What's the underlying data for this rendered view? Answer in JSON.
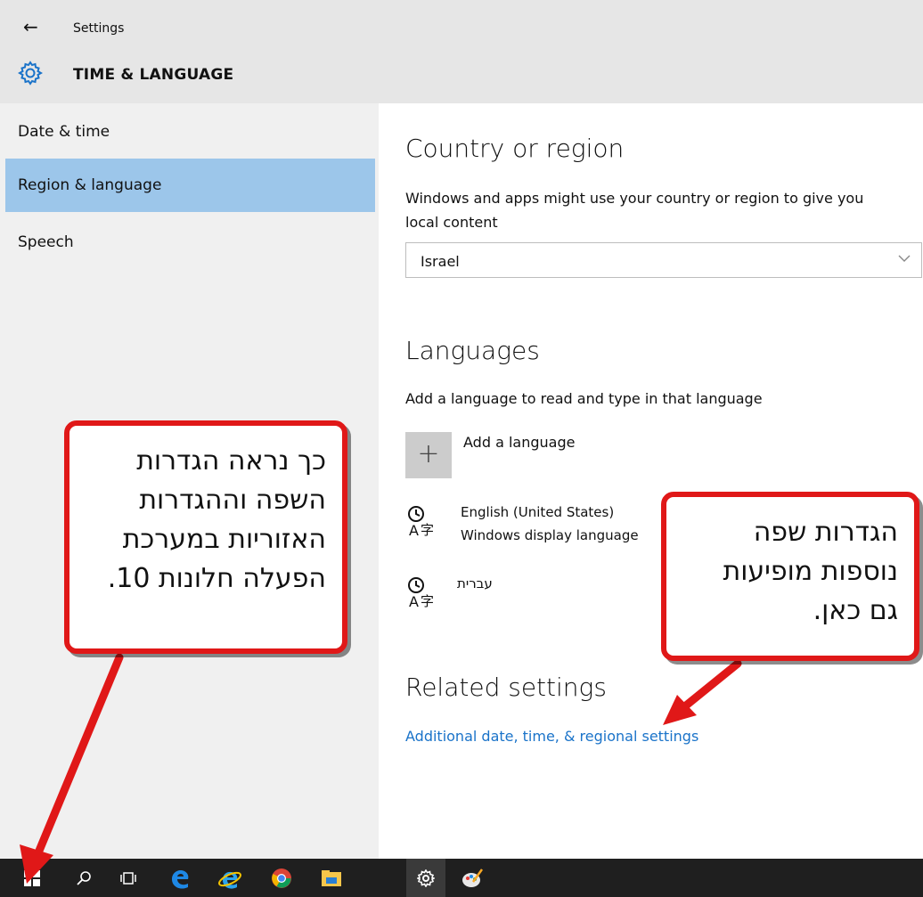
{
  "header": {
    "back_icon": "back-arrow-icon",
    "app_title": "Settings",
    "section_icon": "gear-icon",
    "section_title": "TIME & LANGUAGE"
  },
  "sidebar": {
    "items": [
      {
        "label": "Date & time",
        "selected": false
      },
      {
        "label": "Region & language",
        "selected": true
      },
      {
        "label": "Speech",
        "selected": false
      }
    ]
  },
  "country": {
    "heading": "Country or region",
    "description_line1": "Windows and apps might use your country or region to give you",
    "description_line2": "local content",
    "selected_value": "Israel"
  },
  "languages": {
    "heading": "Languages",
    "description": "Add a language to read and type in that language",
    "add_label": "Add a language",
    "items": [
      {
        "name": "English (United States)",
        "subtitle": "Windows display language"
      },
      {
        "name": "עברית",
        "subtitle": ""
      }
    ]
  },
  "related": {
    "heading": "Related settings",
    "link": "Additional date, time, & regional settings"
  },
  "callouts": {
    "left": [
      "כך נראה הגדרות",
      "השפה וההגדרות",
      "האזוריות במערכת",
      "הפעלה חלונות 10."
    ],
    "right": [
      "הגדרות שפה",
      "נוספות מופיעות",
      "גם כאן."
    ]
  },
  "colors": {
    "selected_nav": "#9cc6ea",
    "link": "#1a73c9",
    "callout_border": "#e01818",
    "taskbar": "#1f1f1f",
    "header": "#e6e6e6"
  },
  "taskbar": {
    "icons": [
      "start-windows-icon",
      "search-icon",
      "task-view-icon",
      "edge-icon",
      "internet-explorer-icon",
      "chrome-icon",
      "file-explorer-icon",
      "settings-gear-icon",
      "paint-icon"
    ]
  }
}
